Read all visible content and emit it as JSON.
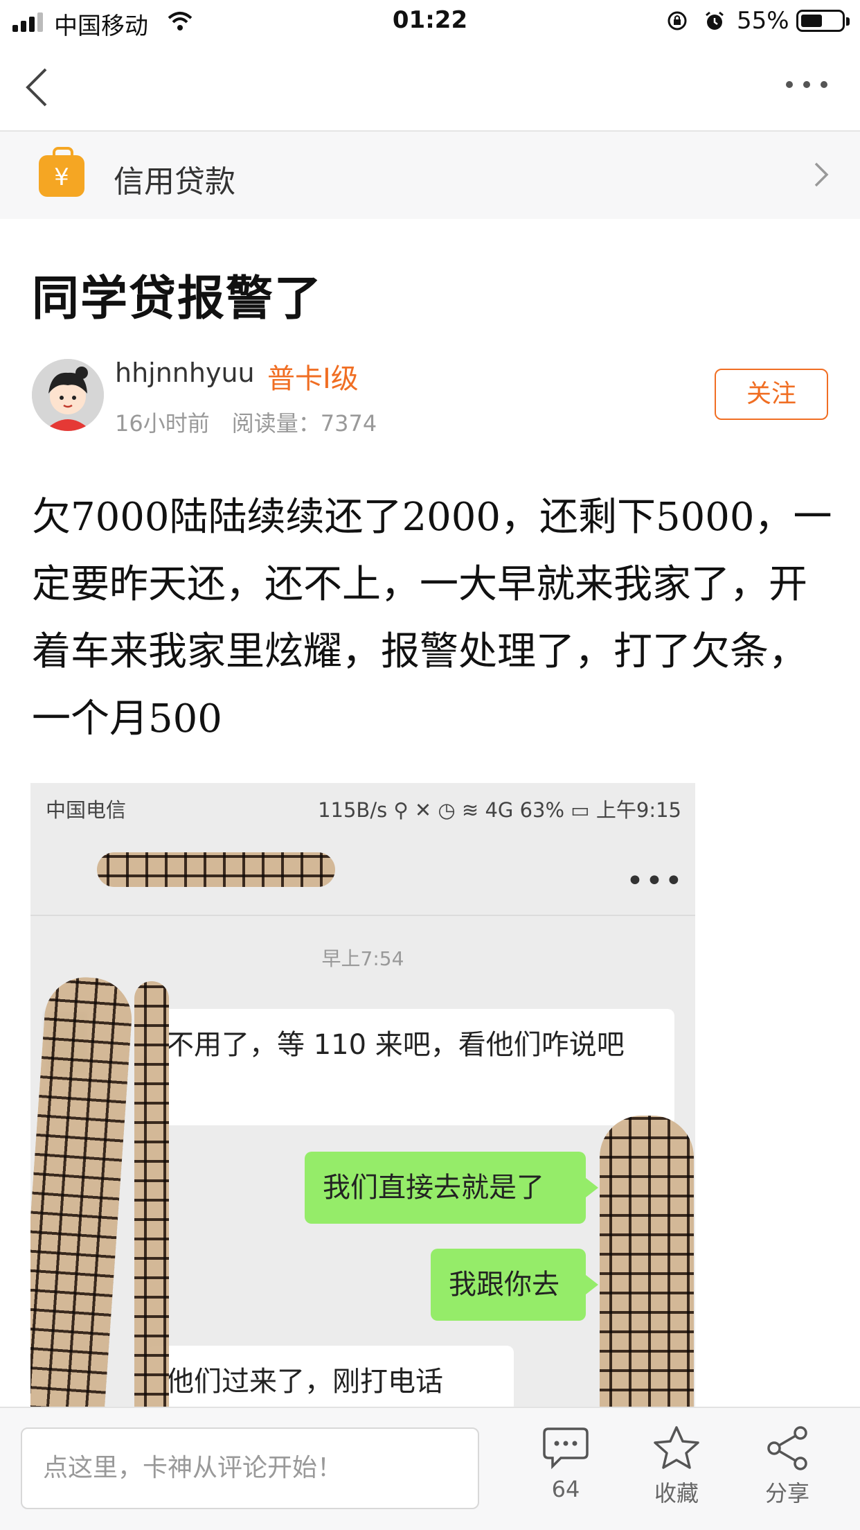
{
  "status_bar": {
    "carrier": "中国移动",
    "time": "01:22",
    "battery": "55%"
  },
  "category": {
    "label": "信用贷款",
    "icon": "¥"
  },
  "post": {
    "title": "同学贷报警了",
    "author": "hhjnnhyuu",
    "level": "普卡I级",
    "time_ago": "16小时前",
    "reads": "阅读量：7374",
    "follow": "关注",
    "body": "欠7000陆陆续续还了2000，还剩下5000，一定要昨天还，还不上，一大早就来我家了，开着车来我家里炫耀，报警处理了，打了欠条，一个月500"
  },
  "screenshot": {
    "status_left": "中国电信",
    "status_right": "115B/s  ⚲ ✕ ◷ ≋ 4G 63% ▭ 上午9:15",
    "chat_time": "早上7:54",
    "msg1": "不用了，等 110 来吧，看他们咋说吧",
    "msg2": "我们直接去就是了",
    "msg3": "我跟你去",
    "msg4": "他们过来了，刚打电话",
    "more": "•••"
  },
  "bottom_bar": {
    "comment_placeholder": "点这里，卡神从评论开始！",
    "comments_count": "64",
    "favorite": "收藏",
    "share": "分享"
  },
  "colors": {
    "accent": "#f06e23",
    "category_icon": "#f5a623",
    "bubble_green": "#95ec69"
  }
}
